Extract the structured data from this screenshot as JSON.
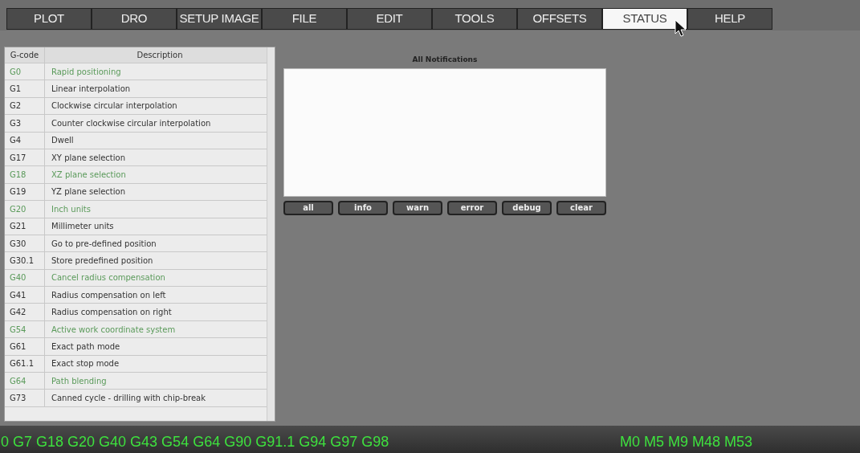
{
  "tabs": [
    {
      "label": "PLOT",
      "selected": false
    },
    {
      "label": "DRO",
      "selected": false
    },
    {
      "label": "SETUP IMAGE",
      "selected": false
    },
    {
      "label": "FILE",
      "selected": false
    },
    {
      "label": "EDIT",
      "selected": false
    },
    {
      "label": "TOOLS",
      "selected": false
    },
    {
      "label": "OFFSETS",
      "selected": false
    },
    {
      "label": "STATUS",
      "selected": true
    },
    {
      "label": "HELP",
      "selected": false
    }
  ],
  "gcode_table": {
    "columns": [
      "G-code",
      "Description"
    ],
    "rows": [
      {
        "code": "G0",
        "description": "Rapid positioning",
        "active": true
      },
      {
        "code": "G1",
        "description": "Linear interpolation",
        "active": false
      },
      {
        "code": "G2",
        "description": "Clockwise circular interpolation",
        "active": false
      },
      {
        "code": "G3",
        "description": "Counter clockwise circular interpolation",
        "active": false
      },
      {
        "code": "G4",
        "description": "Dwell",
        "active": false
      },
      {
        "code": "G17",
        "description": "XY plane selection",
        "active": false
      },
      {
        "code": "G18",
        "description": "XZ plane selection",
        "active": true
      },
      {
        "code": "G19",
        "description": "YZ plane selection",
        "active": false
      },
      {
        "code": "G20",
        "description": "Inch units",
        "active": true
      },
      {
        "code": "G21",
        "description": "Millimeter units",
        "active": false
      },
      {
        "code": "G30",
        "description": "Go to pre-defined position",
        "active": false
      },
      {
        "code": "G30.1",
        "description": "Store predefined position",
        "active": false
      },
      {
        "code": "G40",
        "description": "Cancel radius compensation",
        "active": true
      },
      {
        "code": "G41",
        "description": "Radius compensation on left",
        "active": false
      },
      {
        "code": "G42",
        "description": "Radius compensation on right",
        "active": false
      },
      {
        "code": "G54",
        "description": "Active work coordinate system",
        "active": true
      },
      {
        "code": "G61",
        "description": "Exact path mode",
        "active": false
      },
      {
        "code": "G61.1",
        "description": "Exact stop mode",
        "active": false
      },
      {
        "code": "G64",
        "description": "Path blending",
        "active": true
      },
      {
        "code": "G73",
        "description": "Canned cycle - drilling with chip-break",
        "active": false
      }
    ]
  },
  "notifications": {
    "title": "All Notifications",
    "buttons": [
      "all",
      "info",
      "warn",
      "error",
      "debug",
      "clear"
    ]
  },
  "status_bar": {
    "active_gcodes": "0 G7 G18 G20 G40 G43 G54 G64 G90 G91.1 G94 G97 G98",
    "active_mcodes": "M0 M5 M9 M48 M53"
  }
}
